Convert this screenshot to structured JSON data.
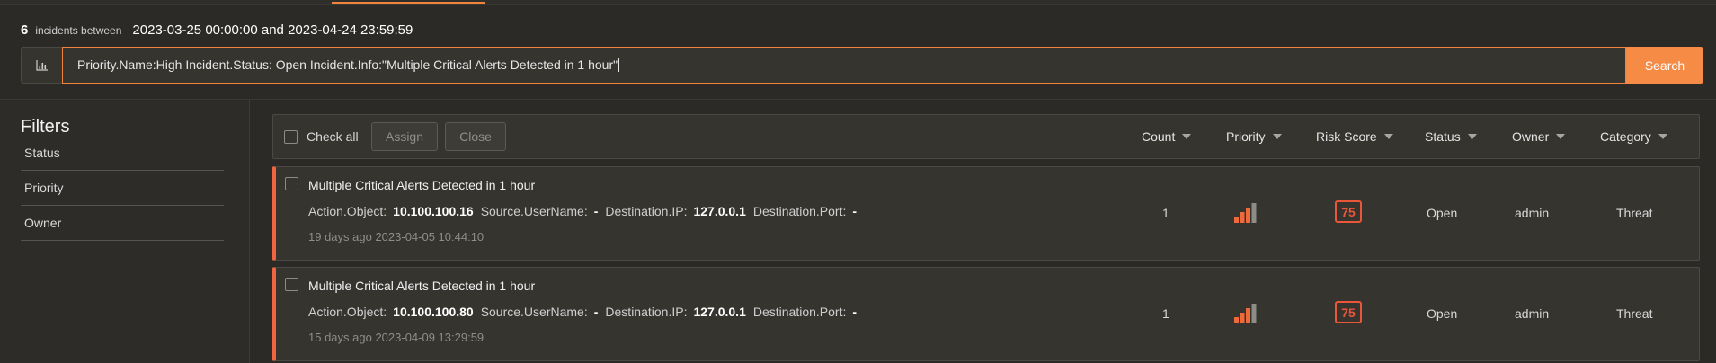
{
  "header": {
    "count": "6",
    "between_label": "incidents between",
    "range": "2023-03-25 00:00:00 and 2023-04-24 23:59:59"
  },
  "search": {
    "query": "Priority.Name:High Incident.Status: Open Incident.Info:\"Multiple Critical Alerts Detected in 1 hour\"",
    "button_label": "Search",
    "chart_icon": "bar-chart-icon"
  },
  "filters": {
    "title": "Filters",
    "items": [
      "Status",
      "Priority",
      "Owner"
    ]
  },
  "toolbar": {
    "check_all": "Check all",
    "assign": "Assign",
    "close": "Close",
    "columns": [
      "Count",
      "Priority",
      "Risk Score",
      "Status",
      "Owner",
      "Category"
    ]
  },
  "incidents": [
    {
      "title": "Multiple Critical Alerts Detected in 1 hour",
      "fields": [
        {
          "key": "Action.Object:",
          "value": "10.100.100.16"
        },
        {
          "key": "Source.UserName:",
          "value": "-"
        },
        {
          "key": "Destination.IP:",
          "value": "127.0.0.1"
        },
        {
          "key": "Destination.Port:",
          "value": "-"
        }
      ],
      "time": "19 days ago 2023-04-05 10:44:10",
      "count": "1",
      "priority_level": 3,
      "priority_max": 4,
      "risk_score": "75",
      "status": "Open",
      "owner": "admin",
      "category": "Threat"
    },
    {
      "title": "Multiple Critical Alerts Detected in 1 hour",
      "fields": [
        {
          "key": "Action.Object:",
          "value": "10.100.100.80"
        },
        {
          "key": "Source.UserName:",
          "value": "-"
        },
        {
          "key": "Destination.IP:",
          "value": "127.0.0.1"
        },
        {
          "key": "Destination.Port:",
          "value": "-"
        }
      ],
      "time": "15 days ago 2023-04-09 13:29:59",
      "count": "1",
      "priority_level": 3,
      "priority_max": 4,
      "risk_score": "75",
      "status": "Open",
      "owner": "admin",
      "category": "Threat"
    }
  ],
  "colors": {
    "accent": "#f68b45",
    "risk": "#e9563a",
    "priority_on": "#ee6a3a",
    "priority_off": "#8d8c87"
  }
}
